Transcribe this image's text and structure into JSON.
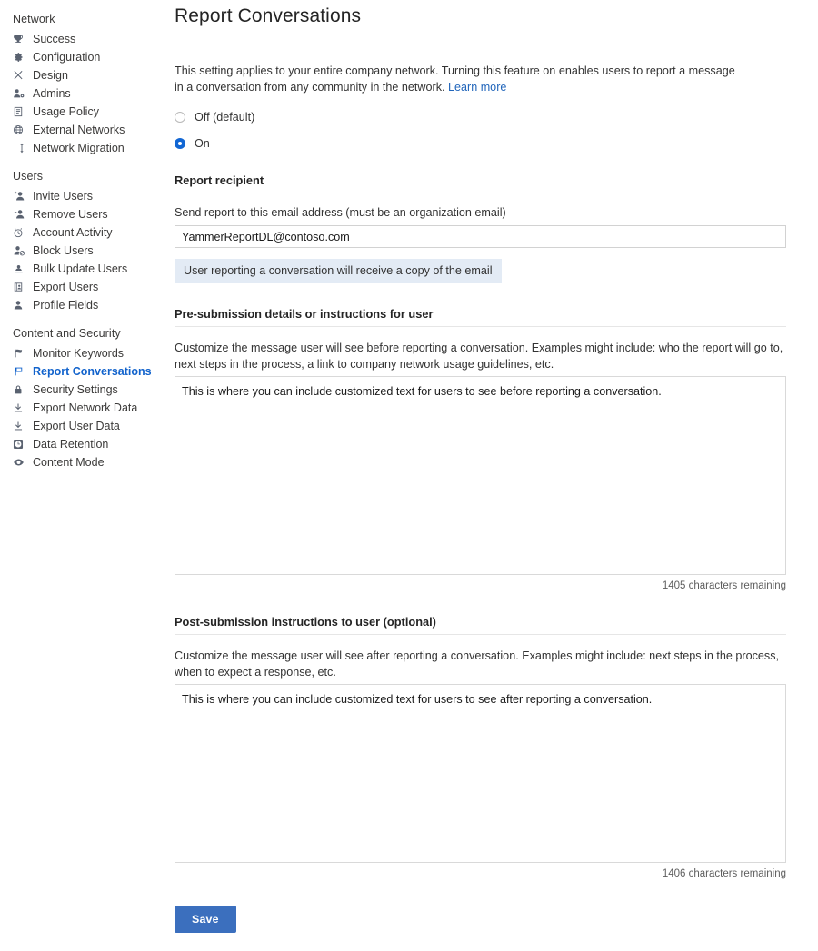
{
  "sidebar": {
    "groups": [
      {
        "title": "Network",
        "items": [
          {
            "label": "Success",
            "icon": "trophy-icon",
            "active": false
          },
          {
            "label": "Configuration",
            "icon": "gear-icon",
            "active": false
          },
          {
            "label": "Design",
            "icon": "design-brush-icon",
            "active": false
          },
          {
            "label": "Admins",
            "icon": "person-gear-icon",
            "active": false
          },
          {
            "label": "Usage Policy",
            "icon": "document-icon",
            "active": false
          },
          {
            "label": "External Networks",
            "icon": "globe-icon",
            "active": false
          },
          {
            "label": "Network Migration",
            "icon": "migration-arrows-icon",
            "active": false
          }
        ]
      },
      {
        "title": "Users",
        "items": [
          {
            "label": "Invite Users",
            "icon": "person-add-icon",
            "active": false
          },
          {
            "label": "Remove Users",
            "icon": "person-remove-icon",
            "active": false
          },
          {
            "label": "Account Activity",
            "icon": "clock-icon",
            "active": false
          },
          {
            "label": "Block Users",
            "icon": "person-block-icon",
            "active": false
          },
          {
            "label": "Bulk Update Users",
            "icon": "bulk-update-icon",
            "active": false
          },
          {
            "label": "Export Users",
            "icon": "export-users-icon",
            "active": false
          },
          {
            "label": "Profile Fields",
            "icon": "person-icon",
            "active": false
          }
        ]
      },
      {
        "title": "Content and Security",
        "items": [
          {
            "label": "Monitor Keywords",
            "icon": "flag-filled-icon",
            "active": false
          },
          {
            "label": "Report Conversations",
            "icon": "flag-outline-icon",
            "active": true
          },
          {
            "label": "Security Settings",
            "icon": "lock-icon",
            "active": false
          },
          {
            "label": "Export Network Data",
            "icon": "download-icon",
            "active": false
          },
          {
            "label": "Export User Data",
            "icon": "download-icon",
            "active": false
          },
          {
            "label": "Data Retention",
            "icon": "clock-circle-icon",
            "active": false
          },
          {
            "label": "Content Mode",
            "icon": "eye-icon",
            "active": false
          }
        ]
      }
    ]
  },
  "main": {
    "title": "Report Conversations",
    "intro": "This setting applies to your entire company network. Turning this feature on enables users to report a message in a conversation from any community in the network.",
    "learn_more": "Learn more",
    "radios": [
      {
        "label": "Off (default)",
        "checked": false
      },
      {
        "label": "On",
        "checked": true
      }
    ],
    "recipient": {
      "header": "Report recipient",
      "field_label": "Send report to this email address (must be an organization email)",
      "email_value": "YammerReportDL@contoso.com",
      "email_placeholder": "",
      "info_banner": "User reporting a conversation will receive a copy of the email"
    },
    "pre_submission": {
      "header": "Pre-submission details or instructions for user",
      "help": "Customize the message user will see before reporting a conversation. Examples might include: who the report will go to, next steps in the process, a link to company network usage guidelines, etc.",
      "value": "This is where you can include customized text for users to see before reporting a conversation.",
      "placeholder": "",
      "characters_remaining": "1405 characters remaining"
    },
    "post_submission": {
      "header": "Post-submission instructions to user (optional)",
      "help": "Customize the message user will see after reporting a conversation. Examples might include: next steps in the process, when to expect a response, etc.",
      "value": "This is where you can include customized text for users to see after reporting a conversation.",
      "placeholder": "",
      "characters_remaining": "1406 characters remaining"
    },
    "save_label": "Save"
  },
  "colors": {
    "accent": "#1267d4",
    "link": "#2266bb",
    "save_button": "#3b6fbe",
    "info_banner_bg": "#e3ebf5"
  }
}
